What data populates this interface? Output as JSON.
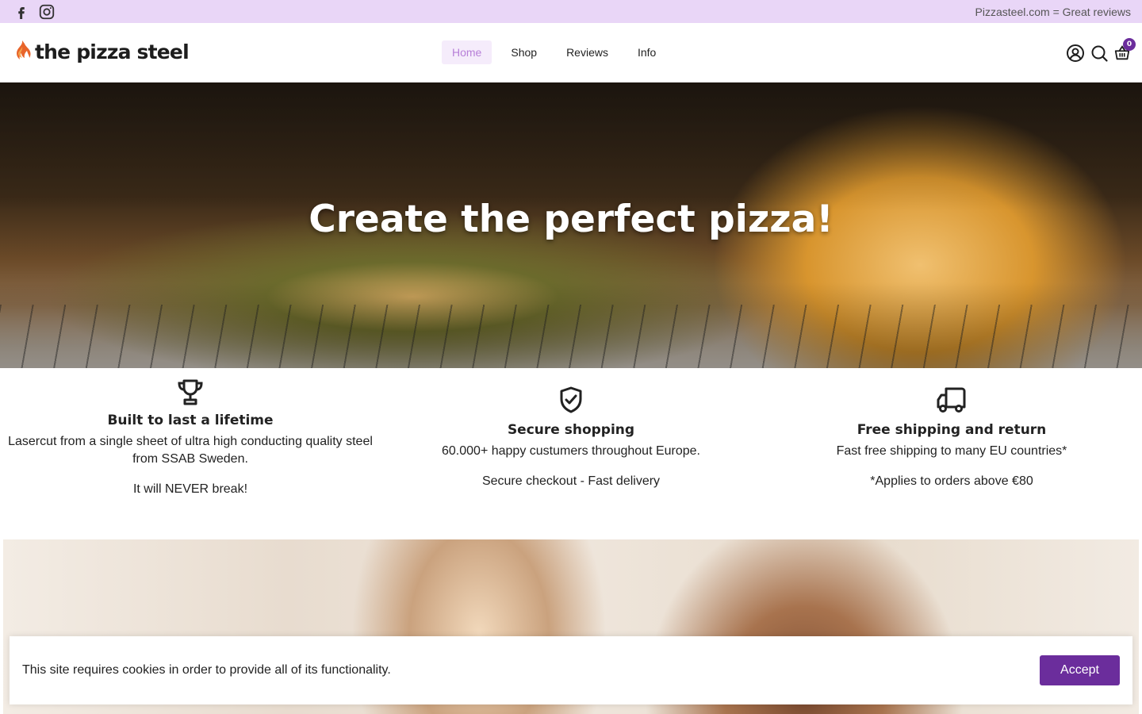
{
  "topbar": {
    "announcement": "Pizzasteel.com = Great reviews",
    "social": [
      "facebook-icon",
      "instagram-icon"
    ],
    "background": "#e9d6f7"
  },
  "header": {
    "logo_text": "the pizza steel",
    "nav": [
      {
        "label": "Home",
        "active": true
      },
      {
        "label": "Shop",
        "active": false
      },
      {
        "label": "Reviews",
        "active": false
      },
      {
        "label": "Info",
        "active": false
      }
    ],
    "icons": [
      "account-icon",
      "search-icon",
      "cart-icon"
    ],
    "cart_count": "0"
  },
  "hero": {
    "title": "Create the perfect pizza!"
  },
  "features": [
    {
      "icon": "trophy-icon",
      "title": "Built to last a lifetime",
      "line1": "Lasercut from a single sheet of ultra high conducting quality steel from SSAB Sweden.",
      "line2": "It will NEVER break!"
    },
    {
      "icon": "shield-check-icon",
      "title": "Secure shopping",
      "line1": "60.000+ happy custumers throughout Europe.",
      "line2": "Secure checkout - Fast delivery"
    },
    {
      "icon": "truck-icon",
      "title": "Free shipping and return",
      "line1": "Fast free shipping to many EU countries*",
      "line2": "*Applies to orders above €80"
    }
  ],
  "cookie": {
    "message": "This site requires cookies in order to provide all of its functionality.",
    "accept_label": "Accept"
  },
  "colors": {
    "accent": "#6b2d9c",
    "nav_active": "#b77fd8",
    "logo_flame": "#e8642a"
  }
}
